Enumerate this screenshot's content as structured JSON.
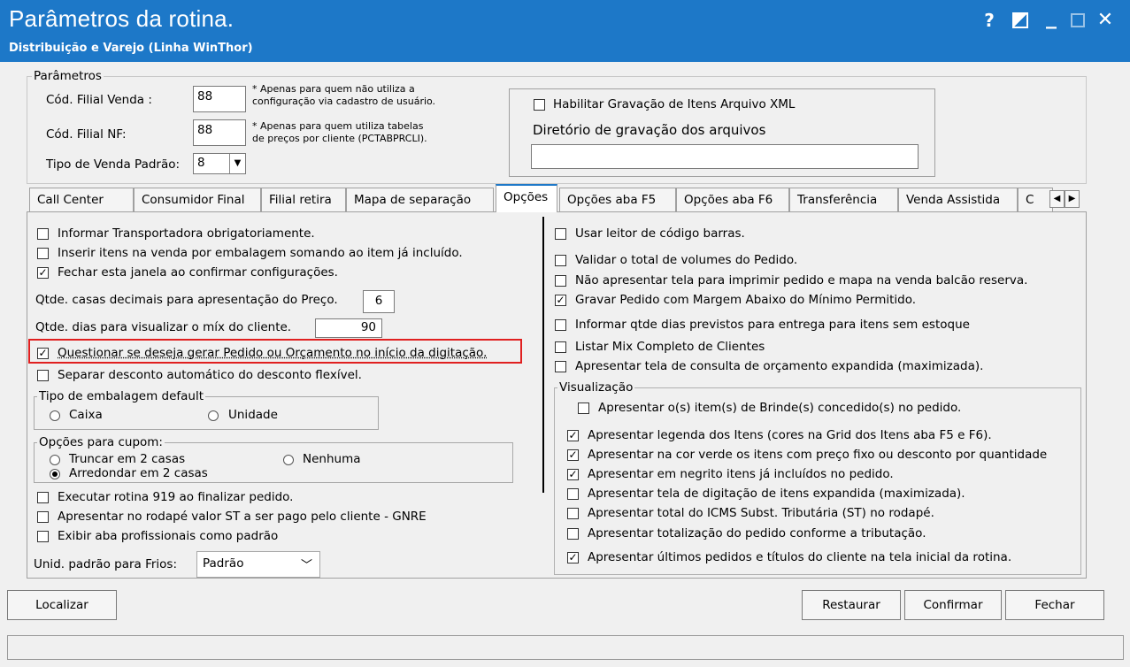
{
  "window": {
    "title": "Parâmetros da rotina.",
    "subtitle": "Distribuição e Varejo (Linha WinThor)",
    "help_glyph": "?",
    "min_glyph": "_",
    "close_glyph": "✕"
  },
  "params": {
    "group_title": "Parâmetros",
    "filial_venda_label": "Cód. Filial Venda :",
    "filial_venda_value": "88",
    "filial_venda_note_1": "* Apenas para quem não utiliza a",
    "filial_venda_note_2": "configuração via cadastro de usuário.",
    "filial_nf_label": "Cód. Filial NF:",
    "filial_nf_value": "88",
    "filial_nf_note_1": "* Apenas para quem utiliza tabelas",
    "filial_nf_note_2": "de preços por cliente (PCTABPRCLI).",
    "tipo_venda_label": "Tipo de Venda Padrão:",
    "tipo_venda_value": "8",
    "xml_checkbox_label": "Habilitar Gravação de Itens Arquivo XML",
    "diretorio_label": "Diretório de gravação dos arquivos",
    "diretorio_value": ""
  },
  "tabs": [
    {
      "label": "Call Center"
    },
    {
      "label": "Consumidor Final"
    },
    {
      "label": "Filial retira"
    },
    {
      "label": "Mapa de separação"
    },
    {
      "label": "Opções"
    },
    {
      "label": "Opções aba F5"
    },
    {
      "label": "Opções aba F6"
    },
    {
      "label": "Transferência"
    },
    {
      "label": "Venda Assistida"
    },
    {
      "label": "C"
    }
  ],
  "left": {
    "cb_transportadora": "Informar Transportadora obrigatoriamente.",
    "cb_inserir_itens": "Inserir itens na venda por embalagem somando ao item já incluído.",
    "cb_fechar_janela": "Fechar esta janela ao confirmar configurações.",
    "casas_decimais_label": "Qtde. casas decimais para apresentação do Preço.",
    "casas_decimais_value": "6",
    "dias_mix_label": "Qtde. dias para visualizar o míx do cliente.",
    "dias_mix_value": "90",
    "cb_questionar": "Questionar se deseja gerar Pedido ou Orçamento no início da digitação.",
    "cb_separar_desconto": "Separar desconto automático do desconto flexível.",
    "embalagem_title": "Tipo de embalagem default",
    "rb_caixa": "Caixa",
    "rb_unidade": "Unidade",
    "cupom_title": "Opções para cupom:",
    "rb_truncar": "Truncar em 2 casas",
    "rb_arredondar": "Arredondar em 2 casas",
    "rb_nenhuma": "Nenhuma",
    "cb_rotina_919": "Executar rotina 919 ao finalizar pedido.",
    "cb_gnre": "Apresentar no rodapé valor ST a ser pago pelo cliente - GNRE",
    "cb_profissionais": "Exibir aba profissionais como padrão",
    "frios_label": "Unid. padrão para Frios:",
    "frios_value": "Padrão"
  },
  "right": {
    "cb_leitor": "Usar leitor de código barras.",
    "cb_validar_volumes": "Validar o total de volumes do Pedido.",
    "cb_nao_apresentar_tela": "Não apresentar tela para imprimir pedido e mapa na venda balcão reserva.",
    "cb_gravar_margem": "Gravar Pedido com Margem Abaixo do Mínimo Permitido.",
    "cb_qtde_dias_previstos": "Informar qtde dias previstos para entrega para itens sem estoque",
    "cb_listar_mix": "Listar Mix Completo de Clientes",
    "cb_tela_orcamento": "Apresentar tela de consulta de orçamento expandida (maximizada).",
    "visualizacao_title": "Visualização",
    "cb_brinde": "Apresentar o(s) item(s) de Brinde(s) concedido(s) no pedido.",
    "cb_legenda": "Apresentar legenda dos Itens (cores na Grid dos Itens aba F5 e F6).",
    "cb_cor_verde": "Apresentar na cor verde os itens com preço fixo ou desconto por quantidade",
    "cb_negrito": "Apresentar em negrito itens já incluídos no pedido.",
    "cb_tela_digitacao": "Apresentar tela de digitação de itens expandida (maximizada).",
    "cb_total_icms": "Apresentar total do ICMS Subst. Tributária (ST) no rodapé.",
    "cb_totalizacao": "Apresentar totalização do pedido conforme a tributação.",
    "cb_ultimos_pedidos": "Apresentar últimos pedidos e títulos do cliente na tela inicial da rotina."
  },
  "buttons": {
    "localizar": "Localizar",
    "restaurar": "Restaurar",
    "confirmar": "Confirmar",
    "fechar": "Fechar"
  },
  "colors": {
    "titlebar": "#1d78c8",
    "highlight": "#e02020"
  }
}
